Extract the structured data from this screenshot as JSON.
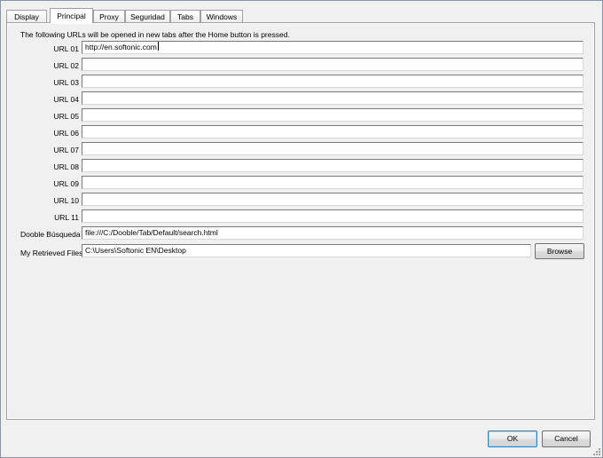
{
  "tabs": [
    {
      "label": "Display",
      "active": false
    },
    {
      "label": "Principal",
      "active": true
    },
    {
      "label": "Proxy",
      "active": false
    },
    {
      "label": "Seguridad",
      "active": false
    },
    {
      "label": "Tabs",
      "active": false
    },
    {
      "label": "Windows",
      "active": false
    }
  ],
  "principal": {
    "info_text": "The following URLs will be opened in new tabs after the Home button is pressed.",
    "urls": [
      {
        "label": "URL 01",
        "value": "http://en.softonic.com"
      },
      {
        "label": "URL 02",
        "value": ""
      },
      {
        "label": "URL 03",
        "value": ""
      },
      {
        "label": "URL 04",
        "value": ""
      },
      {
        "label": "URL 05",
        "value": ""
      },
      {
        "label": "URL 06",
        "value": ""
      },
      {
        "label": "URL 07",
        "value": ""
      },
      {
        "label": "URL 08",
        "value": ""
      },
      {
        "label": "URL 09",
        "value": ""
      },
      {
        "label": "URL 10",
        "value": ""
      },
      {
        "label": "URL 11",
        "value": ""
      }
    ],
    "search": {
      "label": "Dooble Búsqueda",
      "value": "file:///C:/Dooble/Tab/Default/search.html"
    },
    "retrieved": {
      "label": "My Retrieved Files",
      "value": "C:\\Users\\Softonic EN\\Desktop",
      "browse_label": "Browse"
    }
  },
  "footer": {
    "ok_label": "OK",
    "cancel_label": "Cancel"
  }
}
